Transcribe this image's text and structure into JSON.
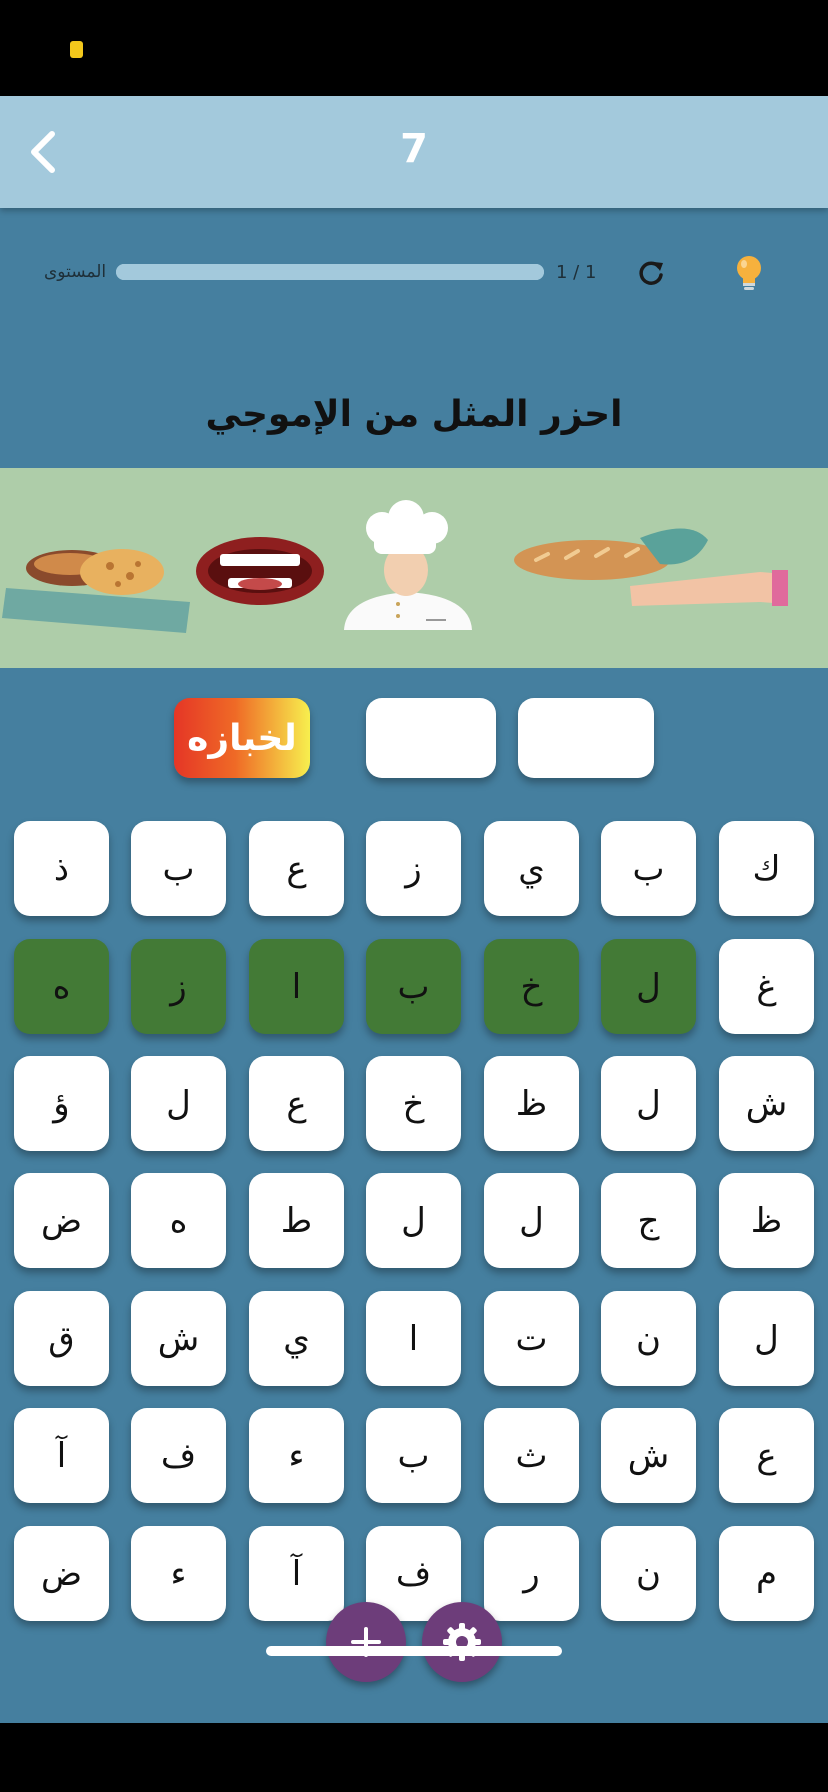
{
  "header": {
    "level_number": "7"
  },
  "progress": {
    "label": "المستوى",
    "count": "1 / 1",
    "value": 1.0
  },
  "puzzle": {
    "title": "احزر المثل من الإموجي",
    "emojis": [
      "bread-icon",
      "mouth-icon",
      "chef-icon",
      "baguette-hand-icon"
    ]
  },
  "answer": {
    "slots": [
      "لخبازه",
      "",
      ""
    ]
  },
  "keyboard": {
    "rows": [
      [
        {
          "l": "ذ",
          "used": false
        },
        {
          "l": "ب",
          "used": false
        },
        {
          "l": "ع",
          "used": false
        },
        {
          "l": "ز",
          "used": false
        },
        {
          "l": "ي",
          "used": false
        },
        {
          "l": "ب",
          "used": false
        },
        {
          "l": "ك",
          "used": false
        }
      ],
      [
        {
          "l": "ه",
          "used": true
        },
        {
          "l": "ز",
          "used": true
        },
        {
          "l": "ا",
          "used": true
        },
        {
          "l": "ب",
          "used": true
        },
        {
          "l": "خ",
          "used": true
        },
        {
          "l": "ل",
          "used": true
        },
        {
          "l": "غ",
          "used": false
        }
      ],
      [
        {
          "l": "ؤ",
          "used": false
        },
        {
          "l": "ل",
          "used": false
        },
        {
          "l": "ع",
          "used": false
        },
        {
          "l": "خ",
          "used": false
        },
        {
          "l": "ظ",
          "used": false
        },
        {
          "l": "ل",
          "used": false
        },
        {
          "l": "ش",
          "used": false
        }
      ],
      [
        {
          "l": "ض",
          "used": false
        },
        {
          "l": "ه",
          "used": false
        },
        {
          "l": "ط",
          "used": false
        },
        {
          "l": "ل",
          "used": false
        },
        {
          "l": "ل",
          "used": false
        },
        {
          "l": "ج",
          "used": false
        },
        {
          "l": "ظ",
          "used": false
        }
      ],
      [
        {
          "l": "ق",
          "used": false
        },
        {
          "l": "ش",
          "used": false
        },
        {
          "l": "ي",
          "used": false
        },
        {
          "l": "ا",
          "used": false
        },
        {
          "l": "ت",
          "used": false
        },
        {
          "l": "ن",
          "used": false
        },
        {
          "l": "ل",
          "used": false
        }
      ],
      [
        {
          "l": "آ",
          "used": false
        },
        {
          "l": "ف",
          "used": false
        },
        {
          "l": "ء",
          "used": false
        },
        {
          "l": "ب",
          "used": false
        },
        {
          "l": "ث",
          "used": false
        },
        {
          "l": "ش",
          "used": false
        },
        {
          "l": "ع",
          "used": false
        }
      ],
      [
        {
          "l": "ض",
          "used": false
        },
        {
          "l": "ء",
          "used": false
        },
        {
          "l": "آ",
          "used": false
        },
        {
          "l": "ف",
          "used": false
        },
        {
          "l": "ر",
          "used": false
        },
        {
          "l": "ن",
          "used": false
        },
        {
          "l": "م",
          "used": false
        }
      ]
    ]
  },
  "fabs": {
    "add_icon": "plus-icon",
    "settings_icon": "gear-icon"
  },
  "colors": {
    "nav": "#a3c9dc",
    "main": "#457f9f",
    "used_key": "#437a36",
    "fab": "#6d3d7a",
    "emoji_band": "#aecda9"
  }
}
